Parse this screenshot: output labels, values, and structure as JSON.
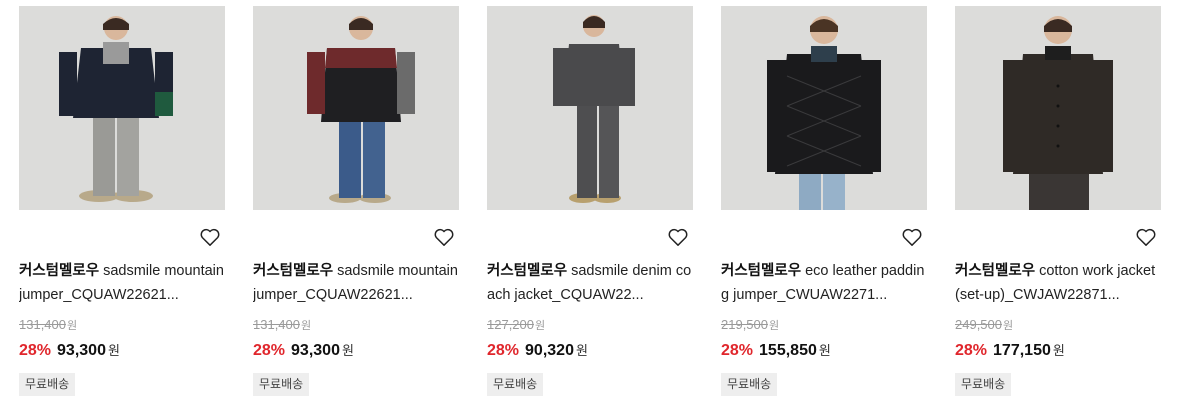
{
  "currency_unit": "원",
  "colors": {
    "discount": "#e0262c",
    "badge_bg": "#eeeeee",
    "thumb_bg": "#dcdcda"
  },
  "products": [
    {
      "brand": "커스텀멜로우",
      "title": "sadsmile mountain jumper_CQUAW22621...",
      "original_price": "131,400",
      "discount": "28%",
      "sale_price": "93,300",
      "badge": "무료배송",
      "icon": "heart-icon"
    },
    {
      "brand": "커스텀멜로우",
      "title": "sadsmile mountain jumper_CQUAW22621...",
      "original_price": "131,400",
      "discount": "28%",
      "sale_price": "93,300",
      "badge": "무료배송",
      "icon": "heart-icon"
    },
    {
      "brand": "커스텀멜로우",
      "title": "sadsmile denim coach jacket_CQUAW22...",
      "original_price": "127,200",
      "discount": "28%",
      "sale_price": "90,320",
      "badge": "무료배송",
      "icon": "heart-icon"
    },
    {
      "brand": "커스텀멜로우",
      "title": "eco leather padding jumper_CWUAW2271...",
      "original_price": "219,500",
      "discount": "28%",
      "sale_price": "155,850",
      "badge": "무료배송",
      "icon": "heart-icon"
    },
    {
      "brand": "커스텀멜로우",
      "title": "cotton work jacket (set-up)_CWJAW22871...",
      "original_price": "249,500",
      "discount": "28%",
      "sale_price": "177,150",
      "badge": "무료배송",
      "icon": "heart-icon"
    }
  ]
}
